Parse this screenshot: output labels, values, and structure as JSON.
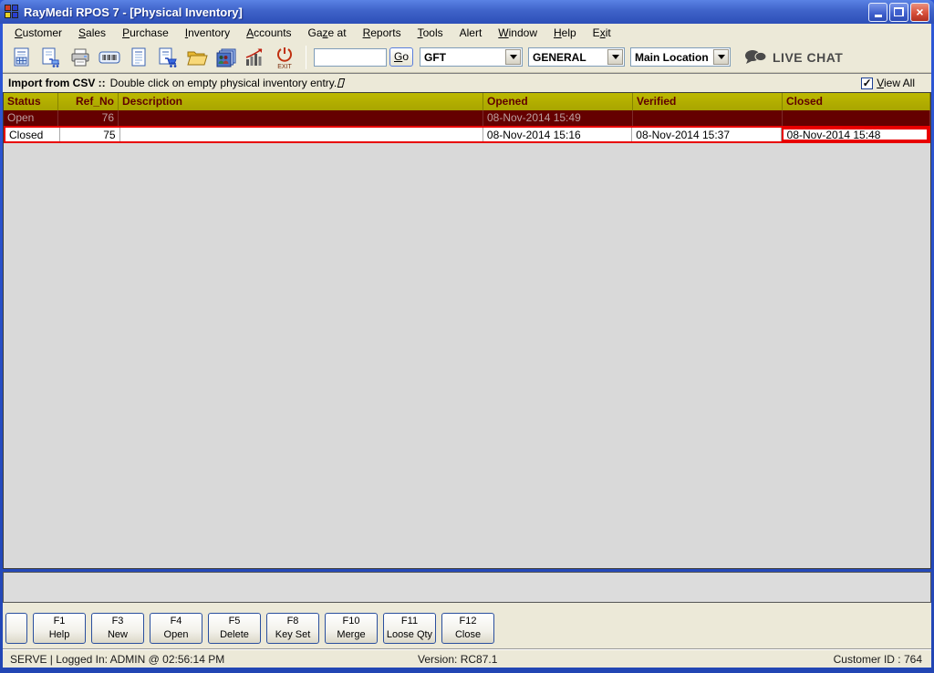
{
  "window": {
    "title": "RayMedi RPOS 7 - [Physical Inventory]"
  },
  "menu": {
    "items": [
      {
        "pre": "",
        "key": "C",
        "post": "ustomer"
      },
      {
        "pre": "",
        "key": "S",
        "post": "ales"
      },
      {
        "pre": "",
        "key": "P",
        "post": "urchase"
      },
      {
        "pre": "",
        "key": "I",
        "post": "nventory"
      },
      {
        "pre": "",
        "key": "A",
        "post": "ccounts"
      },
      {
        "pre": "Ga",
        "key": "z",
        "post": "e at"
      },
      {
        "pre": "",
        "key": "R",
        "post": "eports"
      },
      {
        "pre": "",
        "key": "T",
        "post": "ools"
      },
      {
        "pre": "Alert",
        "key": "",
        "post": ""
      },
      {
        "pre": "",
        "key": "W",
        "post": "indow"
      },
      {
        "pre": "",
        "key": "H",
        "post": "elp"
      },
      {
        "pre": "E",
        "key": "x",
        "post": "it"
      }
    ]
  },
  "toolbar": {
    "icons": [
      "billing",
      "sales-cart",
      "printer",
      "barcode",
      "document",
      "purchase-cart",
      "open-folder",
      "customers",
      "statistics",
      "exit"
    ],
    "exit_label": "EXIT",
    "search_value": "",
    "go": {
      "pre": "",
      "key": "G",
      "post": "o"
    },
    "filters": [
      {
        "value": "GFT"
      },
      {
        "value": "GENERAL"
      },
      {
        "value": "Main Location"
      }
    ],
    "live_chat_label": "LIVE CHAT"
  },
  "infobar": {
    "title": "Import from CSV ::",
    "message": "Double click on empty physical inventory entry.",
    "view_all": {
      "pre": "",
      "key": "V",
      "post": "iew All",
      "checked": true,
      "glyph": "✓"
    }
  },
  "table": {
    "columns": [
      "Status",
      "Ref_No",
      "Description",
      "Opened",
      "Verified",
      "Closed"
    ],
    "rows": [
      {
        "status": "Open",
        "ref_no": "76",
        "description": "",
        "opened": "08-Nov-2014 15:49",
        "verified": "",
        "closed": ""
      },
      {
        "status": "Closed",
        "ref_no": "75",
        "description": "",
        "opened": "08-Nov-2014 15:16",
        "verified": "08-Nov-2014 15:37",
        "closed": "08-Nov-2014 15:48"
      }
    ]
  },
  "fnbar": {
    "buttons": [
      {
        "key": "F1",
        "label": "Help"
      },
      {
        "key": "F3",
        "label": "New"
      },
      {
        "key": "F4",
        "label": "Open"
      },
      {
        "key": "F5",
        "label": "Delete"
      },
      {
        "key": "F8",
        "label": "Key Set"
      },
      {
        "key": "F10",
        "label": "Merge"
      },
      {
        "key": "F11",
        "label": "Loose Qty"
      },
      {
        "key": "F12",
        "label": "Close"
      }
    ]
  },
  "statusbar": {
    "left": "SERVE |  Logged In: ADMIN  @ 02:56:14 PM",
    "version": "Version: RC87.1",
    "customer": "Customer ID : 764"
  },
  "colors": {
    "titlebar_blue": "#3f63c9",
    "chrome_beige": "#ece9d8",
    "grid_header_bg": "#b3af00",
    "grid_header_text": "#600000",
    "row_open_bg": "#650000",
    "row_open_text": "#bc9f9f",
    "selection_red": "#e80000"
  }
}
